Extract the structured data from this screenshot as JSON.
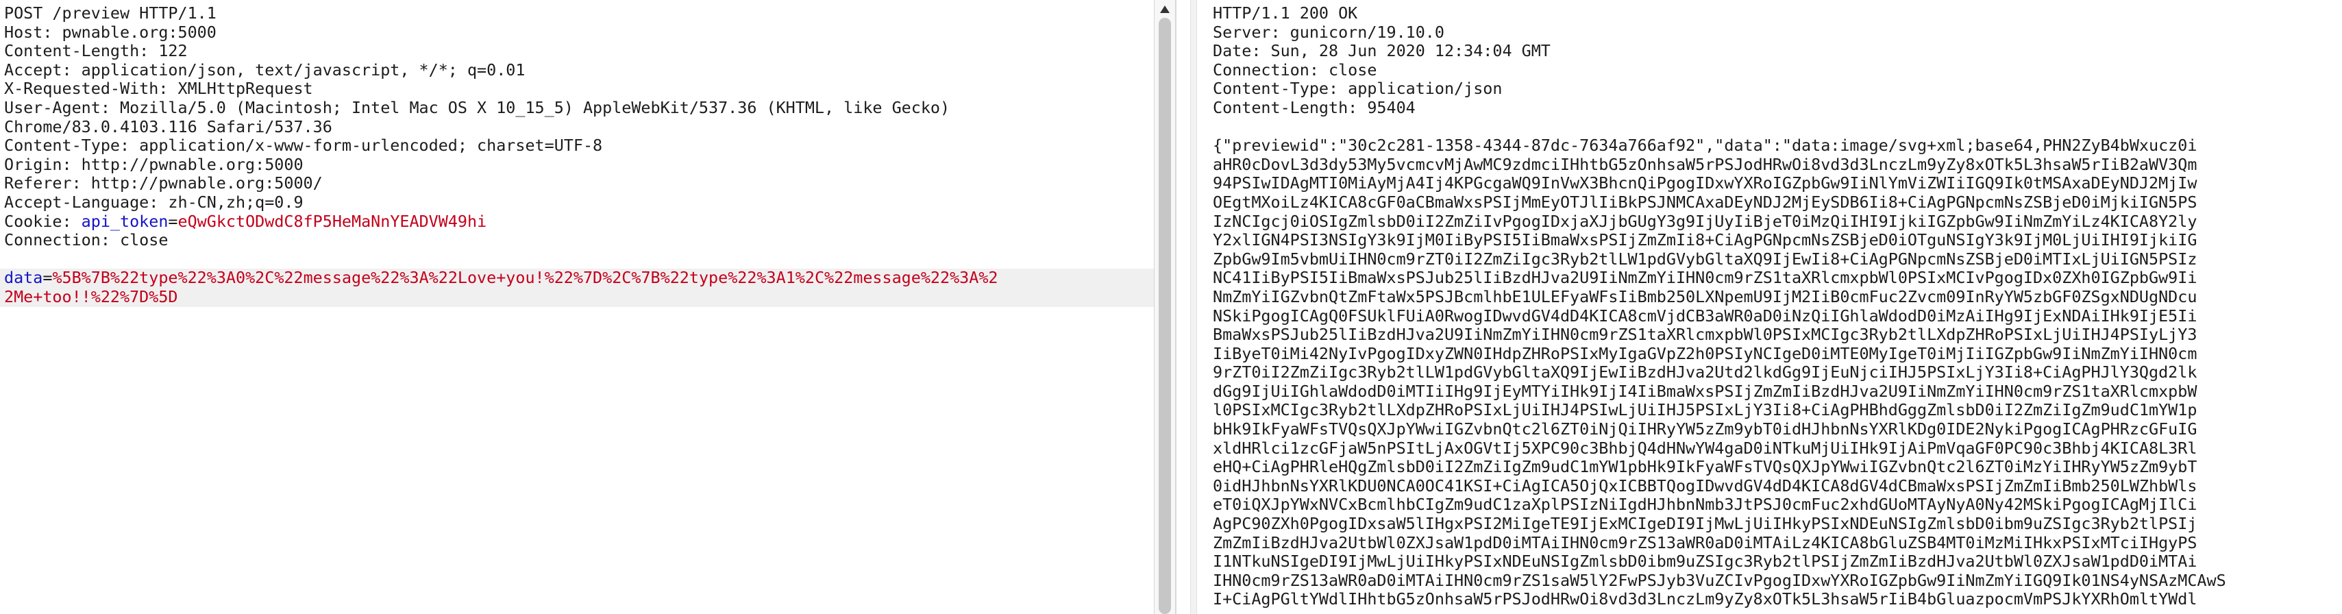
{
  "request": {
    "request_line": "POST /preview HTTP/1.1",
    "headers": [
      "Host: pwnable.org:5000",
      "Content-Length: 122",
      "Accept: application/json, text/javascript, */*; q=0.01",
      "X-Requested-With: XMLHttpRequest",
      "User-Agent: Mozilla/5.0 (Macintosh; Intel Mac OS X 10_15_5) AppleWebKit/537.36 (KHTML, like Gecko)",
      "Chrome/83.0.4103.116 Safari/537.36",
      "Content-Type: application/x-www-form-urlencoded; charset=UTF-8",
      "Origin: http://pwnable.org:5000",
      "Referer: http://pwnable.org:5000/",
      "Accept-Language: zh-CN,zh;q=0.9"
    ],
    "cookie_label": "Cookie: ",
    "cookie_name": "api_token",
    "cookie_eq": "=",
    "cookie_value": "eQwGkctODwdC8fP5HeMaNnYEADVW49hi",
    "connection": "Connection: close",
    "body_param": "data",
    "body_eq": "=",
    "body_value_line1": "%5B%7B%22type%22%3A0%2C%22message%22%3A%22Love+you!%22%7D%2C%7B%22type%22%3A1%2C%22message%22%3A%2",
    "body_value_line2": "2Me+too!!%22%7D%5D"
  },
  "response": {
    "status_line": "HTTP/1.1 200 OK",
    "headers": [
      "Server: gunicorn/19.10.0",
      "Date: Sun, 28 Jun 2020 12:34:04 GMT",
      "Connection: close",
      "Content-Type: application/json",
      "Content-Length: 95404"
    ],
    "body_lines": [
      "{\"previewid\":\"30c2c281-1358-4344-87dc-7634a766af92\",\"data\":\"data:image/svg+xml;base64,PHN2ZyB4bWxucz0i",
      "aHR0cDovL3d3dy53My5vcmcvMjAwMC9zdmciIHhtbG5zOnhsaW5rPSJodHRwOi8vd3d3LnczLm9yZy8xOTk5L3hsaW5rIiB2aWV3Qm",
      "94PSIwIDAgMTI0MiAyMjA4Ij4KPGcgaWQ9InVwX3BhcnQiPgogIDxwYXRoIGZpbGw9IiNlYmViZWIiIGQ9Ik0tMSAxaDEyNDJ2MjIw",
      "OEgtMXoiLz4KICA8cGF0aCBmaWxsPSIjMmEyOTJlIiBkPSJNMCAxaDEyNDJ2MjEySDB6Ii8+CiAgPGNpcmNsZSBjeD0iMjkiIGN5PS",
      "IzNCIgcj0iOSIgZmlsbD0iI2ZmZiIvPgogIDxjaXJjbGUgY3g9IjUyIiBjeT0iMzQiIHI9IjkiIGZpbGw9IiNmZmYiLz4KICA8Y2ly",
      "Y2xlIGN4PSI3NSIgY3k9IjM0IiByPSI5IiBmaWxsPSIjZmZmIi8+CiAgPGNpcmNsZSBjeD0iOTguNSIgY3k9IjM0LjUiIHI9IjkiIG",
      "ZpbGw9Im5vbmUiIHN0cm9rZT0iI2ZmZiIgc3Ryb2tlLW1pdGVybGltaXQ9IjEwIi8+CiAgPGNpcmNsZSBjeD0iMTIxLjUiIGN5PSIz",
      "NC41IiByPSI5IiBmaWxsPSJub25lIiBzdHJva2U9IiNmZmYiIHN0cm9rZS1taXRlcmxpbWl0PSIxMCIvPgogIDx0ZXh0IGZpbGw9Ii",
      "NmZmYiIGZvbnQtZmFtaWx5PSJBcmlhbE1ULEFyaWFsIiBmb250LXNpemU9IjM2IiB0cmFuc2Zvcm09InRyYW5zbGF0ZSgxNDUgNDcu",
      "NSkiPgogICAgQ0FSUklFUiA0RwogIDwvdGV4dD4KICA8cmVjdCB3aWR0aD0iNzQiIGhlaWdodD0iMzAiIHg9IjExNDAiIHk9IjE5Ii",
      "BmaWxsPSJub25lIiBzdHJva2U9IiNmZmYiIHN0cm9rZS1taXRlcmxpbWl0PSIxMCIgc3Ryb2tlLXdpZHRoPSIxLjUiIHJ4PSIyLjY3",
      "IiByeT0iMi42NyIvPgogIDxyZWN0IHdpZHRoPSIxMyIgaGVpZ2h0PSIyNCIgeD0iMTE0MyIgeT0iMjIiIGZpbGw9IiNmZmYiIHN0cm",
      "9rZT0iI2ZmZiIgc3Ryb2tlLW1pdGVybGltaXQ9IjEwIiBzdHJva2Utd2lkdGg9IjEuNjciIHJ5PSIxLjY3Ii8+CiAgPHJlY3Qgd2lk",
      "dGg9IjUiIGhlaWdodD0iMTIiIHg9IjEyMTYiIHk9IjI4IiBmaWxsPSIjZmZmIiBzdHJva2U9IiNmZmYiIHN0cm9rZS1taXRlcmxpbW",
      "l0PSIxMCIgc3Ryb2tlLXdpZHRoPSIxLjUiIHJ4PSIwLjUiIHJ5PSIxLjY3Ii8+CiAgPHBhdGggZmlsbD0iI2ZmZiIgZm9udC1mYW1p",
      "bHk9IkFyaWFsTVQsQXJpYWwiIGZvbnQtc2l6ZT0iNjQiIHRyYW5zZm9ybT0idHJhbnNsYXRlKDg0IDE2NykiPgogICAgPHRzcGFuIG",
      "xldHRlci1zcGFjaW5nPSItLjAxOGVtIj5XPC90c3BhbjQ4dHNwYW4gaD0iNTkuMjUiIHk9IjAiPmVqaGF0PC90c3Bhbj4KICA8L3Rl",
      "eHQ+CiAgPHRleHQgZmlsbD0iI2ZmZiIgZm9udC1mYW1pbHk9IkFyaWFsTVQsQXJpYWwiIGZvbnQtc2l6ZT0iMzYiIHRyYW5zZm9ybT",
      "0idHJhbnNsYXRlKDU0NCA0OC41KSI+CiAgICA5OjQxICBBTQogIDwvdGV4dD4KICA8dGV4dCBmaWxsPSIjZmZmIiBmb250LWZhbWls",
      "eT0iQXJpYWxNVCxBcmlhbCIgZm9udC1zaXplPSIzNiIgdHJhbnNmb3JtPSJ0cmFuc2xhdGUoMTAyNyA0Ny42MSkiPgogICAgMjIlCi",
      "AgPC90ZXh0PgogIDxsaW5lIHgxPSI2MiIgeTE9IjExMCIgeDI9IjMwLjUiIHkyPSIxNDEuNSIgZmlsbD0ibm9uZSIgc3Ryb2tlPSIj",
      "ZmZmIiBzdHJva2UtbWl0ZXJsaW1pdD0iMTAiIHN0cm9rZS13aWR0aD0iMTAiLz4KICA8bGluZSB4MT0iMzMiIHkxPSIxMTciIHgyPS",
      "I1NTkuNSIgeDI9IjMwLjUiIHkyPSIxNDEuNSIgZmlsbD0ibm9uZSIgc3Ryb2tlPSIjZmZmIiBzdHJva2UtbWl0ZXJsaW1pdD0iMTAi",
      "IHN0cm9rZS13aWR0aD0iMTAiIHN0cm9rZS1saW5lY2FwPSJyb3VuZCIvPgogIDxwYXRoIGZpbGw9IiNmZmYiIGQ9Ik01NS4yNSAzMCAwS",
      "I+CiAgPGltYWdlIHhtbG5zOnhsaW5rPSJodHRwOi8vd3d3LnczLm9yZy8xOTk5L3hsaW5rIiB4bGluazpocmVmPSJkYXRhOmltYWdl"
    ]
  }
}
